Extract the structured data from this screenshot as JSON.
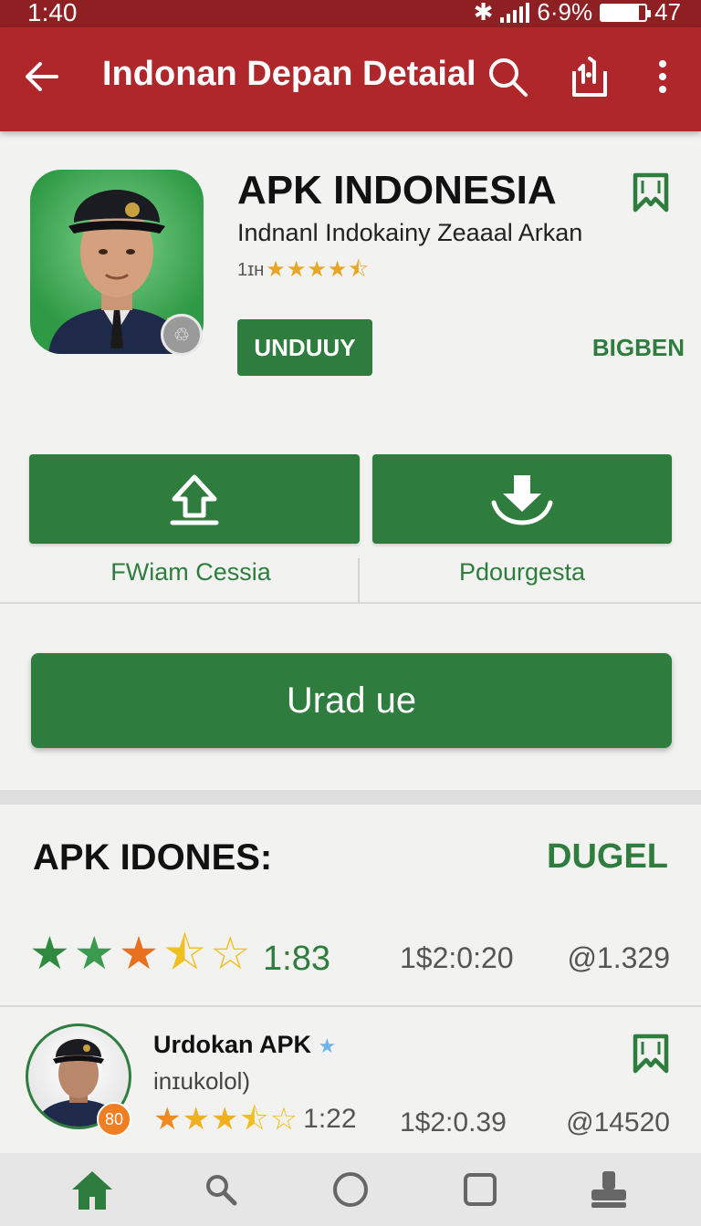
{
  "status_bar": {
    "time": "1:40",
    "battery_text": "6·9%",
    "extra": "47",
    "battery_level": 0.85
  },
  "app_bar": {
    "title": "Indonan Depan Detaial",
    "icons": [
      "back-arrow-icon",
      "search-icon",
      "share-icon",
      "more-vert-icon"
    ]
  },
  "app": {
    "name": "APK INDONESIA",
    "developer": "Indnanl Indokainy Zeaaal Arkan",
    "rating_prefix": "1ɪʜ",
    "rating_stars": 4.5,
    "install_label": "UNDUUY",
    "secondary_link": "BIGBEN"
  },
  "actions": [
    {
      "label": "FWiam Cessia",
      "icon": "upload-icon"
    },
    {
      "label": "Pdourgesta",
      "icon": "download-icon"
    }
  ],
  "main_button": {
    "label": "Urad ue"
  },
  "section": {
    "title": "APK IDONES:",
    "action": "DUGEL"
  },
  "summary": {
    "stars": 3.5,
    "score": "1:83",
    "col2": "1$2:0:20",
    "col3": "@1.329"
  },
  "list_items": [
    {
      "title": "Urdokan APK",
      "subtitle": "inɪukolol)",
      "badge": "80",
      "stars": 3.5,
      "score": "1:22",
      "col2": "1$2:0.39",
      "col3": "@14520"
    }
  ],
  "nav": [
    "home-icon",
    "search-icon",
    "circle-icon",
    "square-icon",
    "stamp-icon"
  ],
  "colors": {
    "red": "#b0272b",
    "green": "#2e7d3e",
    "gold": "#e7a623"
  }
}
